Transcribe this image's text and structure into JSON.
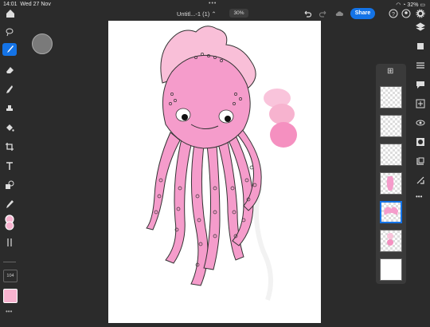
{
  "status": {
    "time": "14:01",
    "date": "Wed 27 Nov",
    "battery": "32%"
  },
  "document": {
    "title": "Untitl...-1 (1)",
    "zoom": "30%"
  },
  "toolbar": {
    "share_label": "Share"
  },
  "tools": {
    "brush_size": "104"
  },
  "colors": {
    "accent": "#1473e6",
    "foreground": "#f7b3cf",
    "octopus": "#f59ccb"
  }
}
